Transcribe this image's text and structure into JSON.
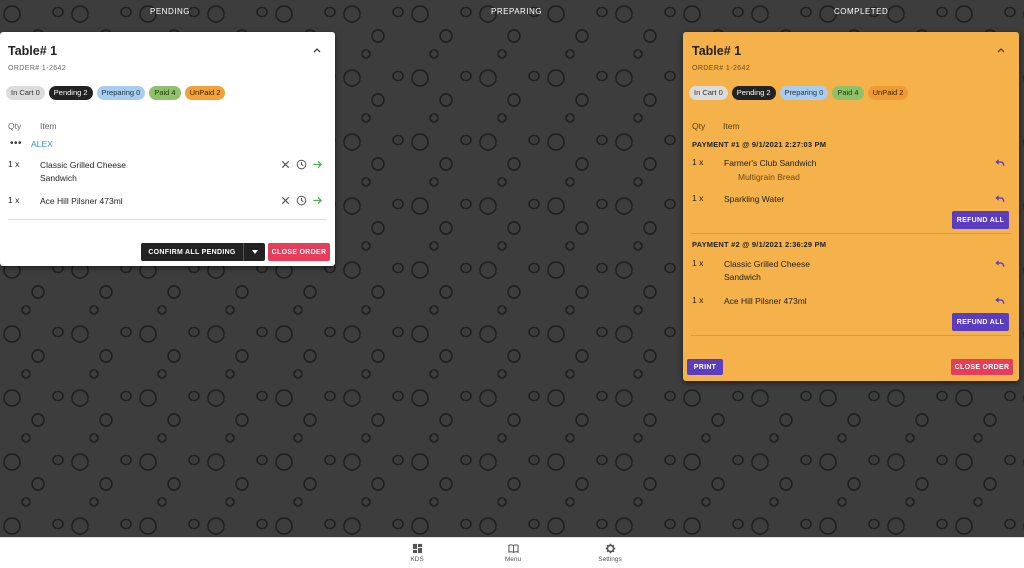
{
  "columns": {
    "pending": "PENDING",
    "preparing": "PREPARING",
    "completed": "COMPLETED"
  },
  "pending_card": {
    "title": "Table# 1",
    "order_no": "ORDER# 1-2642",
    "chips": {
      "in_cart": "In Cart 0",
      "pending": "Pending 2",
      "preparing": "Preparing 0",
      "paid": "Paid 4",
      "unpaid": "UnPaid 2"
    },
    "headers": {
      "qty": "Qty",
      "item": "Item"
    },
    "guest": "ALEX",
    "items": [
      {
        "qty": "1 x",
        "name": "Classic Grilled Cheese Sandwich"
      },
      {
        "qty": "1 x",
        "name": "Ace Hill Pilsner 473ml"
      }
    ],
    "confirm_label": "CONFIRM ALL PENDING",
    "close_label": "CLOSE ORDER"
  },
  "completed_card": {
    "title": "Table# 1",
    "order_no": "ORDER# 1-2642",
    "chips": {
      "in_cart": "In Cart 0",
      "pending": "Pending 2",
      "preparing": "Preparing 0",
      "paid": "Paid 4",
      "unpaid": "UnPaid 2"
    },
    "headers": {
      "qty": "Qty",
      "item": "Item"
    },
    "payments": [
      {
        "header": "PAYMENT #1 @ 9/1/2021 2:27:03 PM",
        "items": [
          {
            "qty": "1 x",
            "name": "Farmer's Club Sandwich",
            "modifier": "Multigrain Bread"
          },
          {
            "qty": "1 x",
            "name": "Sparkling Water"
          }
        ],
        "refund_label": "REFUND ALL"
      },
      {
        "header": "PAYMENT #2 @ 9/1/2021 2:36:29 PM",
        "items": [
          {
            "qty": "1 x",
            "name": "Classic Grilled Cheese Sandwich"
          },
          {
            "qty": "1 x",
            "name": "Ace Hill Pilsner 473ml"
          }
        ],
        "refund_label": "REFUND ALL"
      }
    ],
    "print_label": "PRINT",
    "close_label": "CLOSE ORDER"
  },
  "nav": {
    "kds": "KDS",
    "menu": "Menu",
    "settings": "Settings"
  },
  "icons": {
    "collapse": "chevron-up-icon",
    "cancel": "close-icon",
    "time": "clock-icon",
    "send": "arrow-right-icon",
    "refund": "reply-icon",
    "kds": "dashboard-icon",
    "menu": "book-icon",
    "settings": "gear-icon"
  },
  "colors": {
    "orange_card": "#f5b14a",
    "accent_purple": "#5b3dc0",
    "danger": "#e53d5a",
    "guest_blue": "#3b8bd1",
    "send_green": "#4caf50"
  }
}
